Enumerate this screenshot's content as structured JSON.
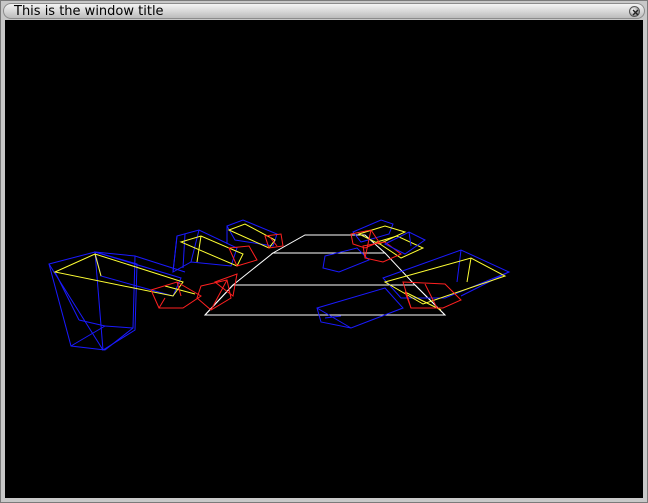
{
  "window": {
    "title": "This is the window title"
  },
  "icons": {
    "close": "close-icon"
  },
  "colors": {
    "titlebar": "#d6d6d6",
    "viewport_background": "#000000",
    "wire_white": "#ffffff",
    "wire_blue": "#1a1aff",
    "wire_yellow": "#ffff33",
    "wire_red": "#ff2020"
  }
}
